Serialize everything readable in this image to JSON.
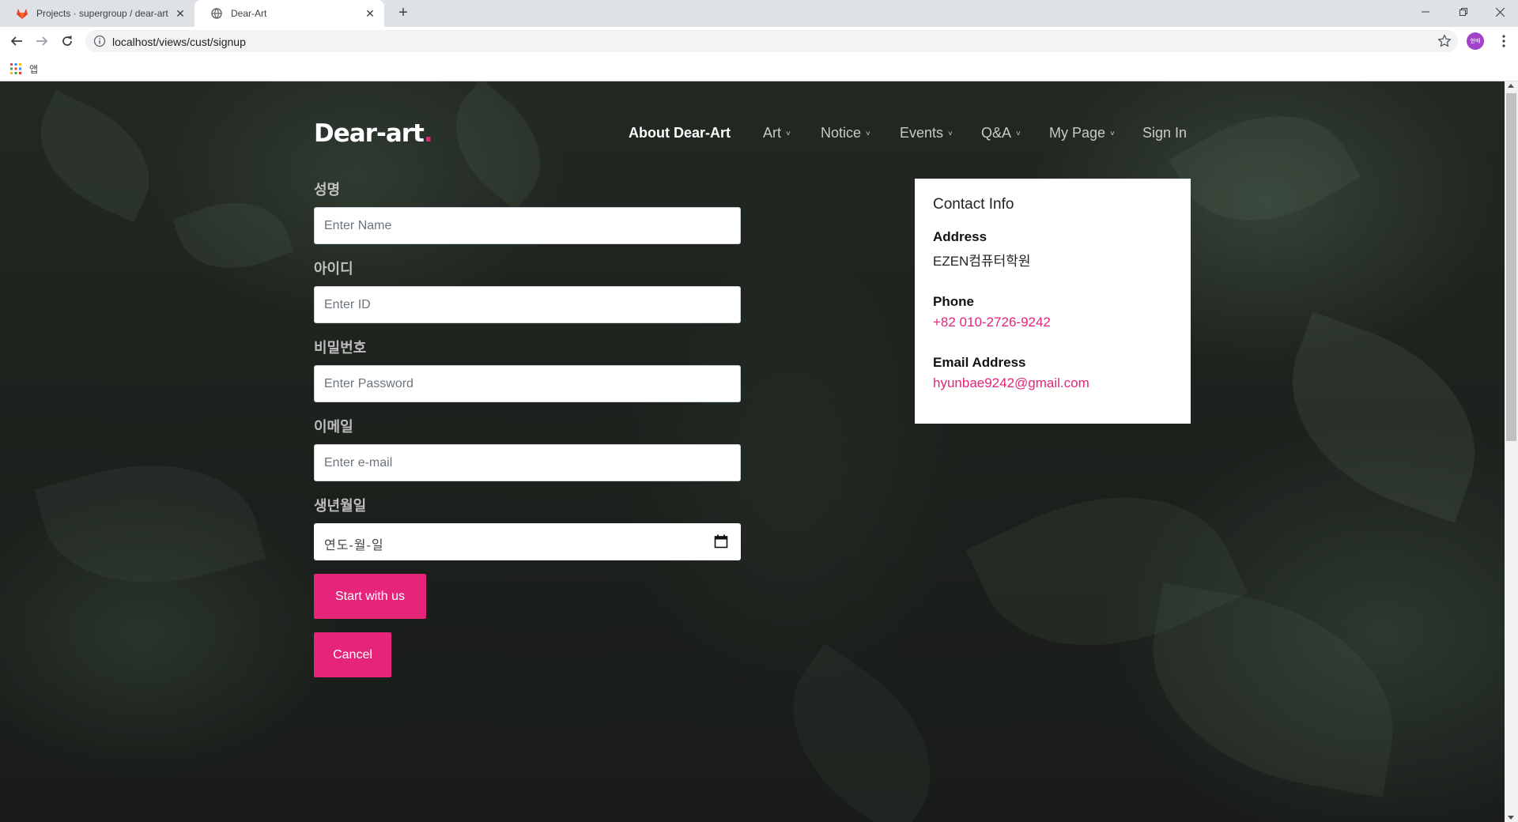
{
  "browser": {
    "tabs": [
      {
        "title": "Projects · supergroup / dear-art",
        "active": false,
        "icon": "gitlab-icon"
      },
      {
        "title": "Dear-Art",
        "active": true,
        "icon": "globe-icon"
      }
    ],
    "url": "localhost/views/cust/signup",
    "profile_initials": "현배",
    "bookmarks_apps_label": "앱"
  },
  "site": {
    "brand": "Dear-art",
    "brand_dot": ".",
    "accent_color": "#e6247a",
    "nav": [
      {
        "label": "About Dear-Art",
        "active": true,
        "dropdown": false
      },
      {
        "label": "Art",
        "active": false,
        "dropdown": true
      },
      {
        "label": "Notice",
        "active": false,
        "dropdown": true
      },
      {
        "label": "Events",
        "active": false,
        "dropdown": true
      },
      {
        "label": "Q&A",
        "active": false,
        "dropdown": true
      },
      {
        "label": "My Page",
        "active": false,
        "dropdown": true
      },
      {
        "label": "Sign In",
        "active": false,
        "dropdown": false
      }
    ]
  },
  "form": {
    "name": {
      "label": "성명",
      "placeholder": "Enter Name"
    },
    "id": {
      "label": "아이디",
      "placeholder": "Enter ID"
    },
    "password": {
      "label": "비밀번호",
      "placeholder": "Enter Password"
    },
    "email": {
      "label": "이메일",
      "placeholder": "Enter e-mail"
    },
    "birth": {
      "label": "생년월일",
      "placeholder": "연도-월-일"
    },
    "submit_label": "Start with us",
    "cancel_label": "Cancel"
  },
  "contact": {
    "title": "Contact Info",
    "address_label": "Address",
    "address": "EZEN컴퓨터학원",
    "phone_label": "Phone",
    "phone": "+82 010-2726-9242",
    "email_label": "Email Address",
    "email": "hyunbae9242@gmail.com"
  }
}
